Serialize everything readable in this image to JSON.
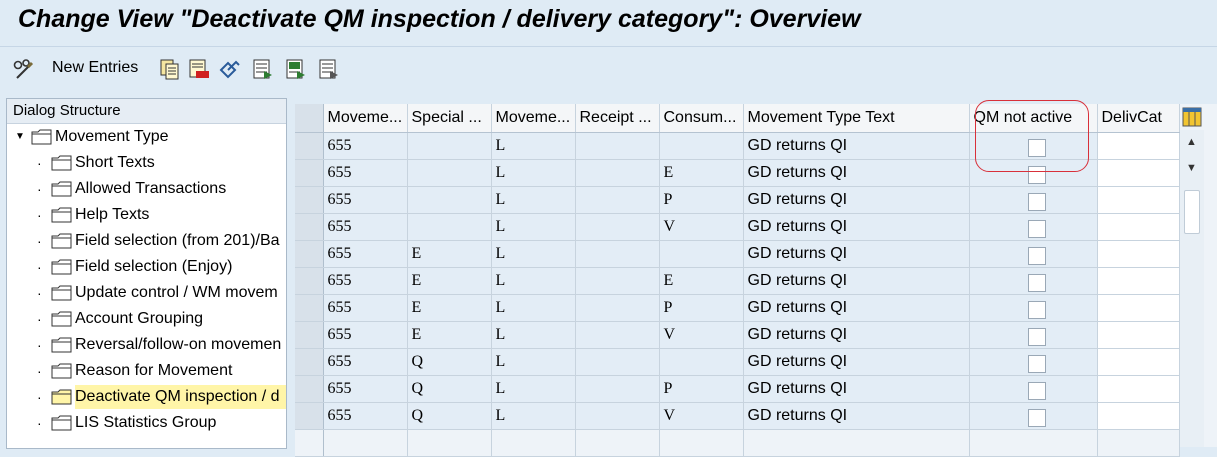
{
  "title": "Change View \"Deactivate QM inspection / delivery category\": Overview",
  "toolbar": {
    "new_entries_label": "New Entries",
    "icons": [
      "glasses-pencil-icon",
      "copy-icon",
      "delete-icon",
      "undo-icon",
      "select-all-icon",
      "select-block-icon",
      "deselect-icon"
    ]
  },
  "dialog_structure": {
    "header": "Dialog Structure",
    "root": "Movement Type",
    "children": [
      "Short Texts",
      "Allowed Transactions",
      "Help Texts",
      "Field selection (from 201)/Ba",
      "Field selection (Enjoy)",
      "Update control / WM movem",
      "Account Grouping",
      "Reversal/follow-on movemen",
      "Reason for Movement",
      "Deactivate QM inspection / d",
      "LIS Statistics Group"
    ],
    "selected_index": 9
  },
  "table": {
    "columns": [
      "Moveme...",
      "Special ...",
      "Moveme...",
      "Receipt ...",
      "Consum...",
      "Movement Type Text",
      "QM not active",
      "DelivCat"
    ],
    "rows": [
      [
        "655",
        "",
        "L",
        "",
        "",
        "GD returns QI"
      ],
      [
        "655",
        "",
        "L",
        "",
        "E",
        "GD returns QI"
      ],
      [
        "655",
        "",
        "L",
        "",
        "P",
        "GD returns QI"
      ],
      [
        "655",
        "",
        "L",
        "",
        "V",
        "GD returns QI"
      ],
      [
        "655",
        "E",
        "L",
        "",
        "",
        "GD returns QI"
      ],
      [
        "655",
        "E",
        "L",
        "",
        "E",
        "GD returns QI"
      ],
      [
        "655",
        "E",
        "L",
        "",
        "P",
        "GD returns QI"
      ],
      [
        "655",
        "E",
        "L",
        "",
        "V",
        "GD returns QI"
      ],
      [
        "655",
        "Q",
        "L",
        "",
        "",
        "GD returns QI"
      ],
      [
        "655",
        "Q",
        "L",
        "",
        "P",
        "GD returns QI"
      ],
      [
        "655",
        "Q",
        "L",
        "",
        "V",
        "GD returns QI"
      ]
    ],
    "qm_not_active_checked": [
      false,
      false,
      false,
      false,
      false,
      false,
      false,
      false,
      false,
      false,
      false
    ]
  },
  "colors": {
    "background": "#dfebf5",
    "highlight_ring": "#d8303a",
    "selected_node": "#fff5a8"
  }
}
